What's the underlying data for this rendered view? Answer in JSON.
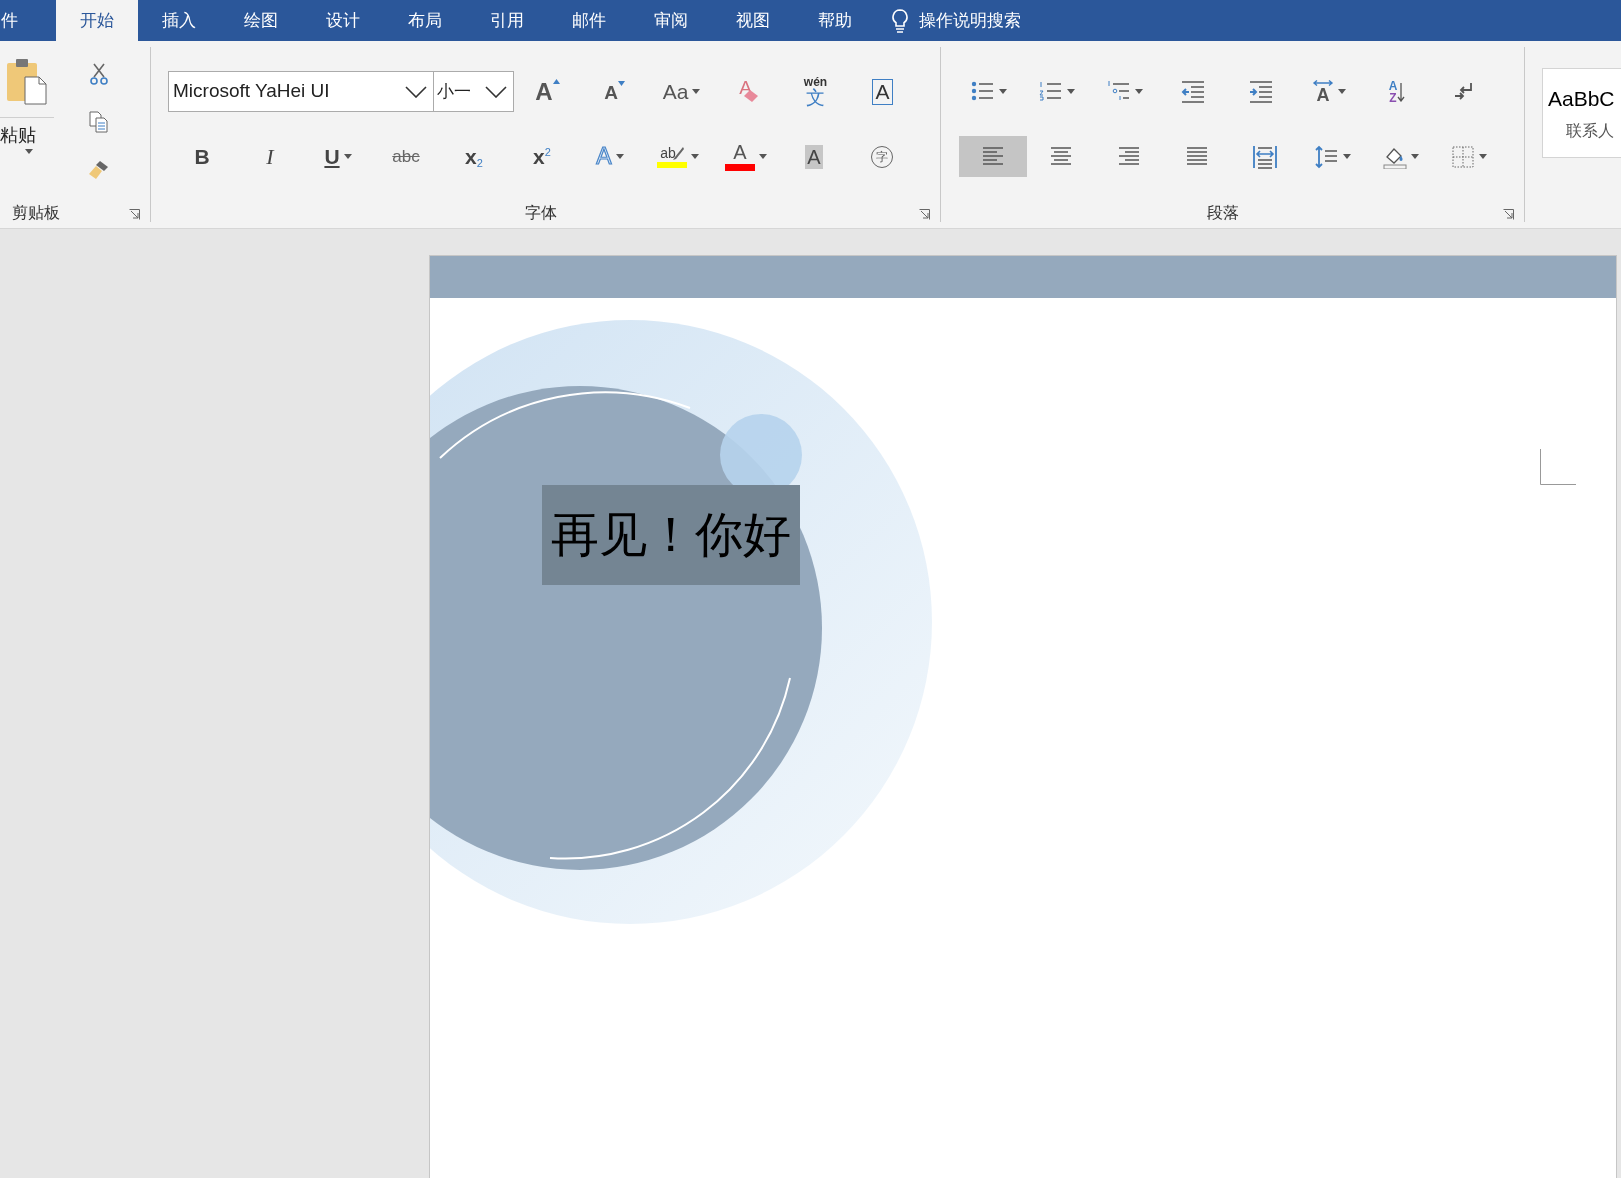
{
  "tabs": [
    {
      "label": "件",
      "selected": false
    },
    {
      "label": "开始",
      "selected": true
    },
    {
      "label": "插入",
      "selected": false
    },
    {
      "label": "绘图",
      "selected": false
    },
    {
      "label": "设计",
      "selected": false
    },
    {
      "label": "布局",
      "selected": false
    },
    {
      "label": "引用",
      "selected": false
    },
    {
      "label": "邮件",
      "selected": false
    },
    {
      "label": "审阅",
      "selected": false
    },
    {
      "label": "视图",
      "selected": false
    },
    {
      "label": "帮助",
      "selected": false
    }
  ],
  "tell_me": "操作说明搜索",
  "clipboard": {
    "paste_label": "粘贴",
    "group_label": "剪贴板"
  },
  "font": {
    "font_name": "Microsoft YaHei UI",
    "font_size": "小一",
    "group_label": "字体",
    "row1": [
      {
        "kind": "grow",
        "glyph": "A",
        "dropdown": false
      },
      {
        "kind": "shrink",
        "glyph": "A",
        "dropdown": false
      },
      {
        "kind": "case",
        "glyph": "Aa",
        "dropdown": true
      },
      {
        "kind": "clear",
        "glyph": "A",
        "dropdown": false
      },
      {
        "kind": "phonetic",
        "glyph": "wén",
        "sub": "文",
        "dropdown": false
      },
      {
        "kind": "border",
        "glyph": "A",
        "dropdown": false
      }
    ],
    "row2": [
      {
        "kind": "bold",
        "glyph": "B",
        "dropdown": false
      },
      {
        "kind": "italic",
        "glyph": "I",
        "dropdown": false
      },
      {
        "kind": "underline",
        "glyph": "U",
        "dropdown": true
      },
      {
        "kind": "strike",
        "glyph": "abc",
        "dropdown": false
      },
      {
        "kind": "subscript",
        "glyph": "x",
        "sub": "2",
        "dropdown": false
      },
      {
        "kind": "superscript",
        "glyph": "x",
        "sub": "2",
        "dropdown": false
      },
      {
        "kind": "effect",
        "glyph": "A",
        "dropdown": true
      },
      {
        "kind": "highlight",
        "glyph": "ab",
        "color": "#ffff00",
        "dropdown": true
      },
      {
        "kind": "fontcolor",
        "glyph": "A",
        "color": "#ff0000",
        "dropdown": true
      },
      {
        "kind": "shading",
        "glyph": "A",
        "dropdown": false
      },
      {
        "kind": "enclose",
        "glyph": "字",
        "dropdown": false
      }
    ]
  },
  "paragraph": {
    "group_label": "段落",
    "row1": [
      {
        "kind": "bullets",
        "dropdown": true
      },
      {
        "kind": "numbering",
        "dropdown": true
      },
      {
        "kind": "multilevel",
        "dropdown": true
      },
      {
        "kind": "decrease_indent",
        "dropdown": false
      },
      {
        "kind": "increase_indent",
        "dropdown": false
      },
      {
        "kind": "asian_layout",
        "glyph": "A",
        "dropdown": true
      },
      {
        "kind": "sort",
        "glyph": "A",
        "sub": "Z",
        "dropdown": false
      },
      {
        "kind": "marks",
        "dropdown": false
      }
    ],
    "alignment": [
      {
        "kind": "left",
        "selected": true
      },
      {
        "kind": "center",
        "selected": false
      },
      {
        "kind": "right",
        "selected": false
      },
      {
        "kind": "justify",
        "selected": false
      },
      {
        "kind": "distributed",
        "selected": false
      }
    ],
    "row2": [
      {
        "kind": "line_spacing",
        "dropdown": true
      },
      {
        "kind": "shading",
        "dropdown": true
      },
      {
        "kind": "borders",
        "dropdown": true
      }
    ]
  },
  "styles": {
    "preview": "AaBbC",
    "label": "联系人"
  },
  "document": {
    "text_box": "再见！你好"
  }
}
